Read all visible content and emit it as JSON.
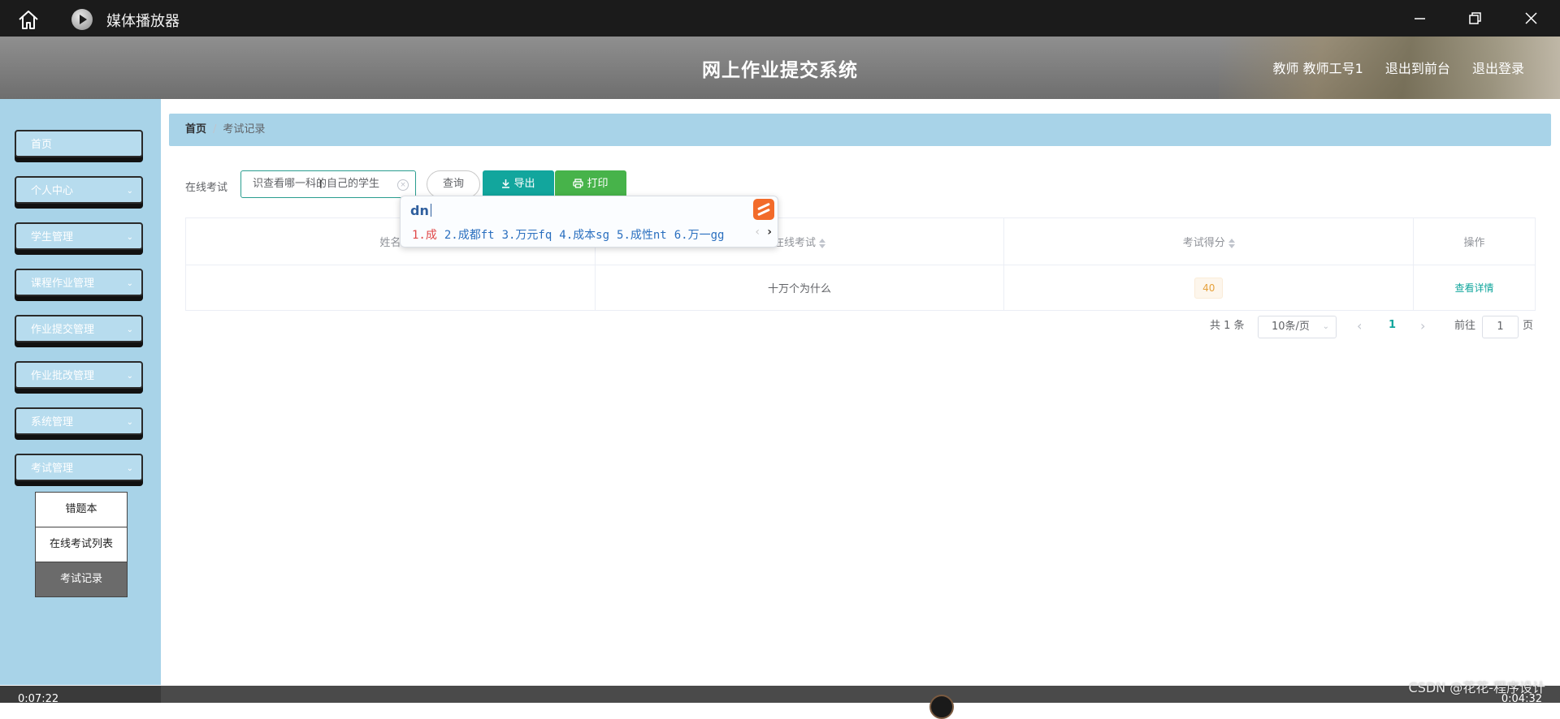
{
  "titlebar": {
    "app_title": "媒体播放器",
    "icons": {
      "home": "home-icon",
      "app": "media-player-icon",
      "minimize": "minimize-icon",
      "restore": "restore-icon",
      "close": "close-icon"
    }
  },
  "header": {
    "site_title": "网上作业提交系统",
    "user_label": "教师 教师工号1",
    "front_link": "退出到前台",
    "logout_link": "退出登录"
  },
  "sidebar": {
    "items": [
      {
        "label": "首页",
        "has_chevron": false
      },
      {
        "label": "个人中心",
        "has_chevron": true
      },
      {
        "label": "学生管理",
        "has_chevron": true
      },
      {
        "label": "课程作业管理",
        "has_chevron": true
      },
      {
        "label": "作业提交管理",
        "has_chevron": true
      },
      {
        "label": "作业批改管理",
        "has_chevron": true
      },
      {
        "label": "系统管理",
        "has_chevron": true
      },
      {
        "label": "考试管理",
        "has_chevron": true
      }
    ],
    "submenu": [
      {
        "label": "错题本"
      },
      {
        "label": "在线考试列表"
      },
      {
        "label": "考试记录",
        "active": true
      }
    ]
  },
  "breadcrumb": {
    "home": "首页",
    "separator": "/",
    "current": "考试记录"
  },
  "search": {
    "label": "在线考试",
    "value": "识查看哪一科的自己的学生",
    "query_button": "查询",
    "export_button": "导出",
    "print_button": "打印"
  },
  "ime": {
    "composition": "dn",
    "candidates": [
      "1.成",
      "2.成都ft",
      "3.万元fq",
      "4.成本sg",
      "5.成性nt",
      "6.万一gg"
    ]
  },
  "table": {
    "columns": [
      "姓名",
      "在线考试",
      "考试得分",
      "操作"
    ],
    "rows": [
      {
        "name": "",
        "exam": "十万个为什么",
        "score": "40",
        "action": "查看详情"
      }
    ]
  },
  "pagination": {
    "total_text": "共 1 条",
    "page_size": "10条/页",
    "current_page": "1",
    "goto_label": "前往",
    "goto_value": "1",
    "page_suffix": "页"
  },
  "player": {
    "time_left": "0:07:22",
    "time_right": "0:04:32"
  },
  "watermark": "CSDN @花花-程序设计",
  "colors": {
    "accent": "#12a69d",
    "print": "#47b34a",
    "sidebar_bg": "#a8d3e8",
    "score_tag": "#e6a23c"
  }
}
